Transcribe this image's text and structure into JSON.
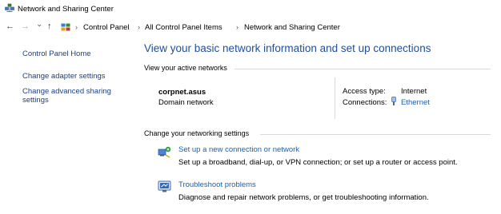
{
  "window": {
    "title": "Network and Sharing Center",
    "title_icon": "network-sharing-icon"
  },
  "nav": {
    "back_icon": "←",
    "forward_icon": "→",
    "recent_icon": "⌄",
    "up_icon": "↑"
  },
  "breadcrumb": {
    "items": [
      "Control Panel",
      "All Control Panel Items",
      "Network and Sharing Center"
    ],
    "separator": "›"
  },
  "sidebar": {
    "items": [
      {
        "label": "Control Panel Home"
      },
      {
        "label": "Change adapter settings"
      },
      {
        "label_line1": "Change advanced sharing",
        "label_line2": "settings"
      }
    ]
  },
  "main": {
    "title": "View your basic network information and set up connections",
    "active_networks_header": "View your active networks",
    "network": {
      "name": "corpnet.asus",
      "category": "Domain network",
      "access_type_label": "Access type:",
      "access_type_value": "Internet",
      "connections_label": "Connections:",
      "connections_value": "Ethernet"
    },
    "change_settings_header": "Change your networking settings",
    "tasks": [
      {
        "icon": "new-connection-icon",
        "link": "Set up a new connection or network",
        "description": "Set up a broadband, dial-up, or VPN connection; or set up a router or access point."
      },
      {
        "icon": "troubleshoot-icon",
        "link": "Troubleshoot problems",
        "description": "Diagnose and repair network problems, or get troubleshooting information."
      }
    ]
  },
  "colors": {
    "link": "#1a5fb4",
    "title": "#1f4e9c",
    "rule": "#d9d9d9"
  }
}
